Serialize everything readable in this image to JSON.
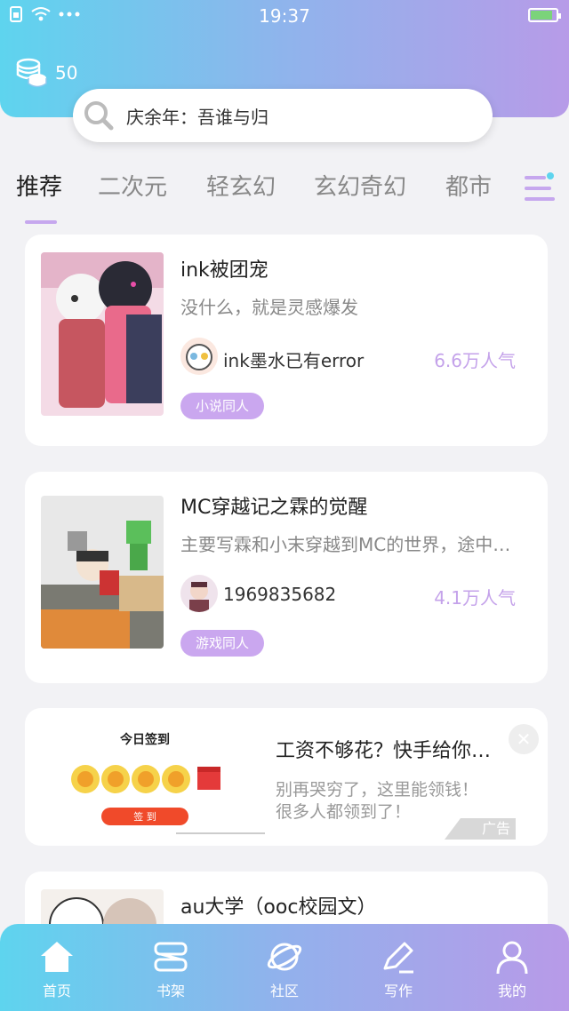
{
  "status_bar": {
    "time": "19:37"
  },
  "wallet": {
    "coins": "50"
  },
  "search": {
    "text": "庆余年：吾谁与归"
  },
  "tabs": [
    {
      "label": "推荐",
      "active": true
    },
    {
      "label": "二次元",
      "active": false
    },
    {
      "label": "轻玄幻",
      "active": false
    },
    {
      "label": "玄幻奇幻",
      "active": false
    },
    {
      "label": "都市",
      "active": false
    }
  ],
  "books": [
    {
      "title": "ink被团宠",
      "description": "没什么，就是灵感爆发",
      "author": "ink墨水已有error",
      "popularity": "6.6万人气",
      "tag": "小说同人"
    },
    {
      "title": "MC穿越记之霖的觉醒",
      "description": "主要写霖和小末穿越到MC的世界，途中…",
      "author": "1969835682",
      "popularity": "4.1万人气",
      "tag": "游戏同人"
    },
    {
      "title": "au大学（ooc校园文）"
    }
  ],
  "ad": {
    "image_heading": "今日签到",
    "image_button": "签 到",
    "title": "工资不够花？快手给你…",
    "description": "别再哭穷了，这里能领钱！很多人都领到了！",
    "badge": "广告"
  },
  "bottom_nav": [
    {
      "label": "首页",
      "icon": "home-icon"
    },
    {
      "label": "书架",
      "icon": "bookshelf-icon"
    },
    {
      "label": "社区",
      "icon": "planet-icon"
    },
    {
      "label": "写作",
      "icon": "pen-icon"
    },
    {
      "label": "我的",
      "icon": "user-icon"
    }
  ],
  "colors": {
    "accent": "#c6a7ee",
    "popularity": "#c4a2ea",
    "gradient_start": "#5ed4ee",
    "gradient_end": "#b89ae8"
  }
}
